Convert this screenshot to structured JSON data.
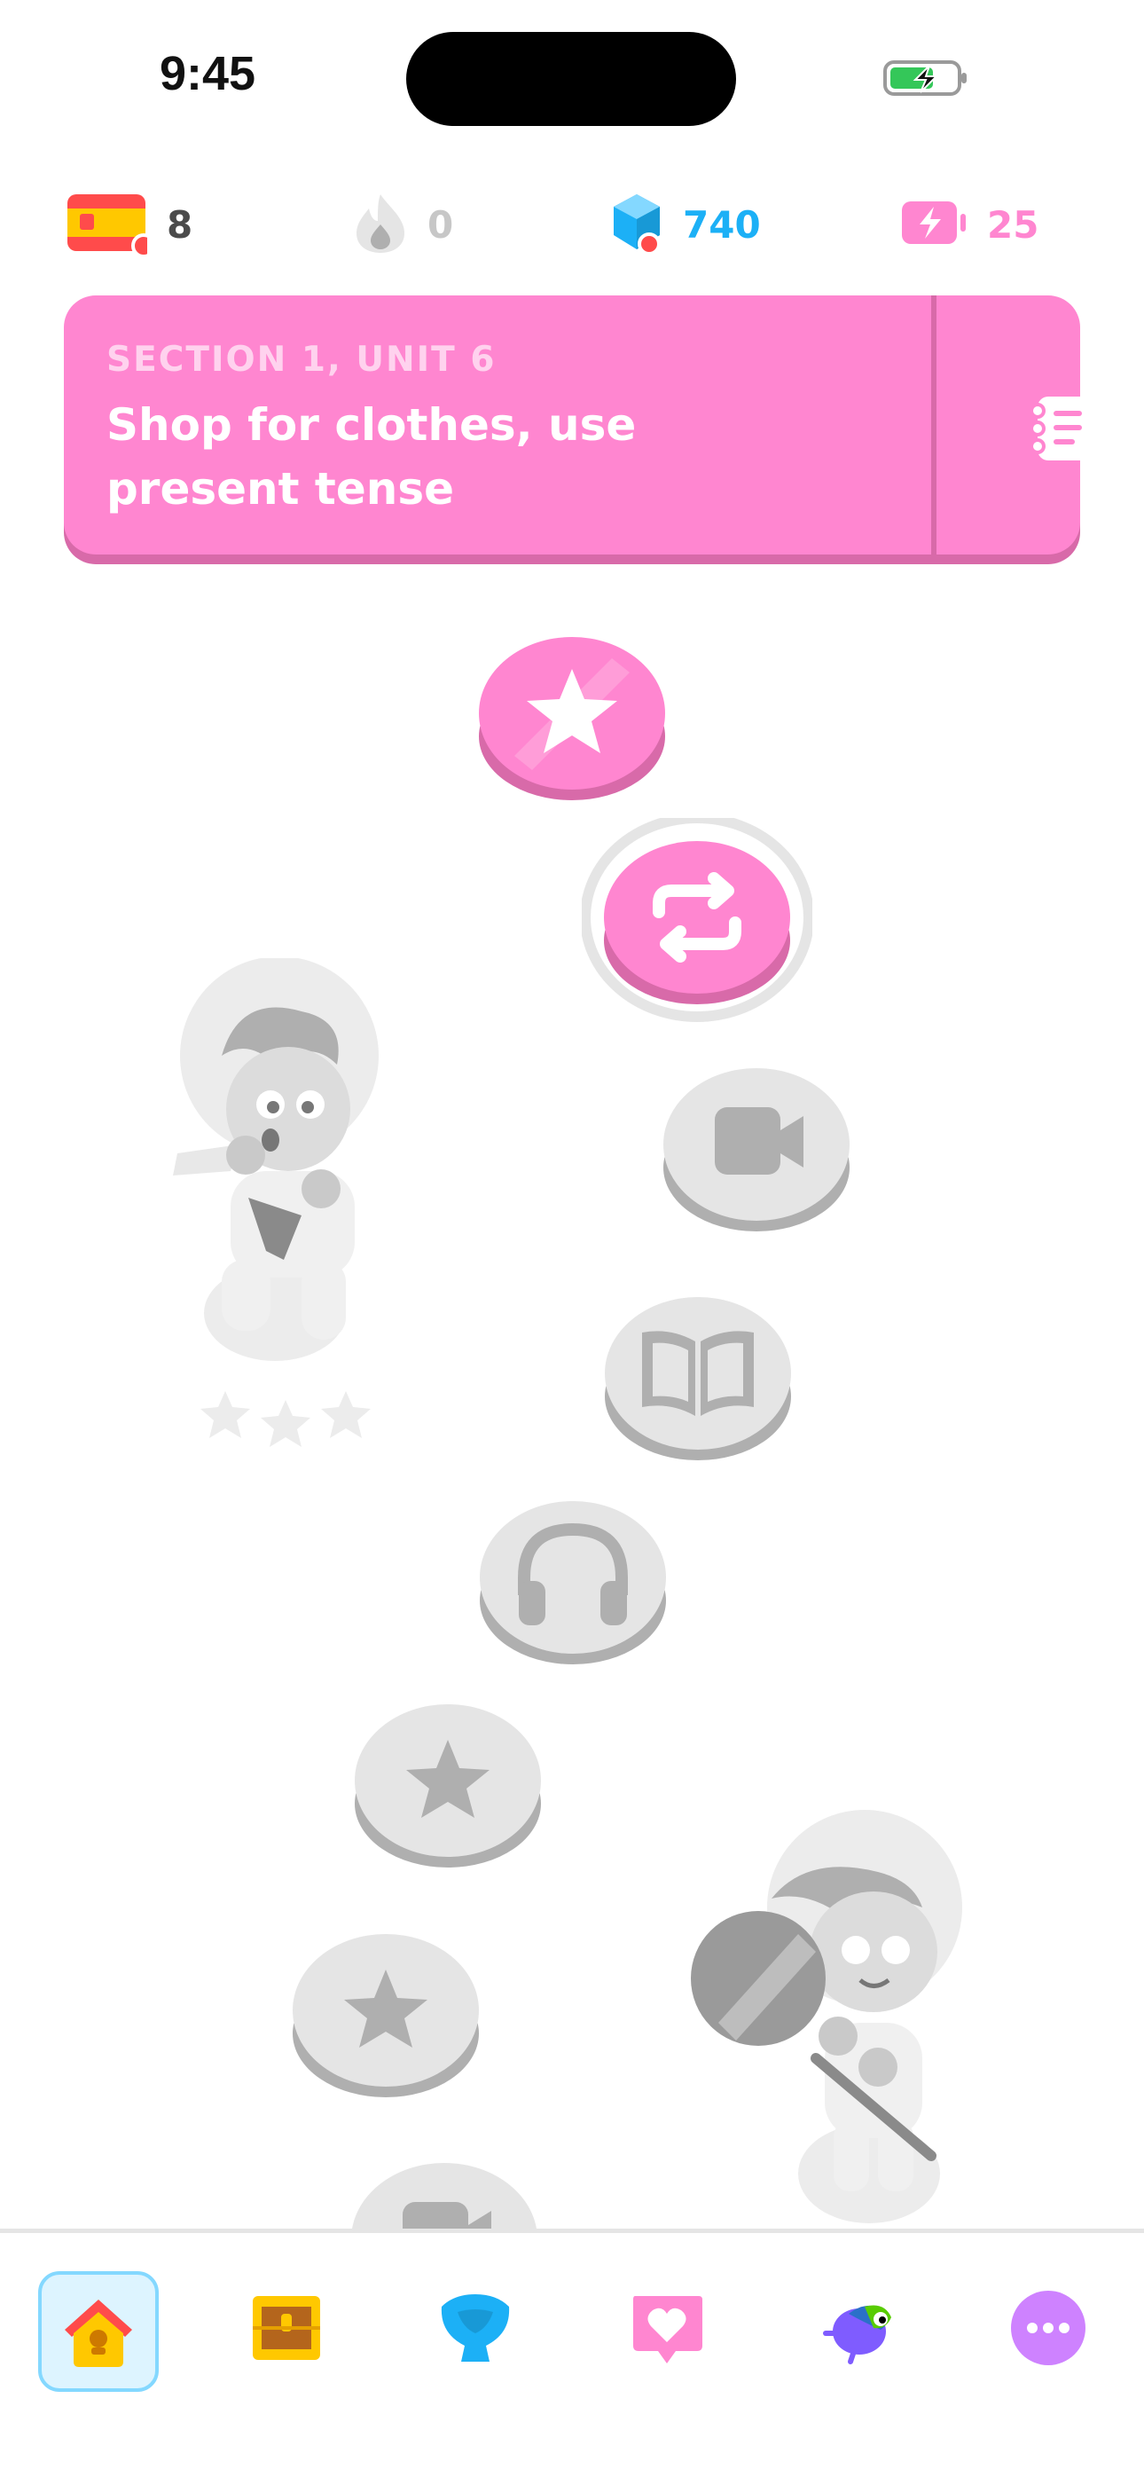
{
  "status_bar": {
    "time": "9:45",
    "battery_icon": "battery-charging-icon"
  },
  "stats": {
    "course_flag": "spain-flag-icon",
    "course_count": "8",
    "streak_count": "0",
    "gems_count": "740",
    "energy_count": "25"
  },
  "unit_banner": {
    "section": "SECTION 1, UNIT 6",
    "title": "Shop for clothes, use present tense",
    "guide_icon": "guidebook-icon"
  },
  "path": {
    "nodes": [
      {
        "type": "star",
        "state": "completed"
      },
      {
        "type": "practice",
        "state": "active"
      },
      {
        "type": "video",
        "state": "locked"
      },
      {
        "type": "story",
        "state": "locked"
      },
      {
        "type": "listening",
        "state": "locked"
      },
      {
        "type": "star",
        "state": "locked"
      },
      {
        "type": "star",
        "state": "locked"
      },
      {
        "type": "video",
        "state": "locked"
      }
    ],
    "characters": [
      "karate-character",
      "astronaut-guitar-character"
    ]
  },
  "nav": {
    "items": [
      "home",
      "chest",
      "leagues",
      "health",
      "practice-hub",
      "more"
    ],
    "active": "home"
  },
  "colors": {
    "brand_pink": "#ff86d0",
    "pink_shadow": "#d86aa9",
    "gem_blue": "#1cb0f6",
    "locked_gray": "#e5e5e5"
  }
}
